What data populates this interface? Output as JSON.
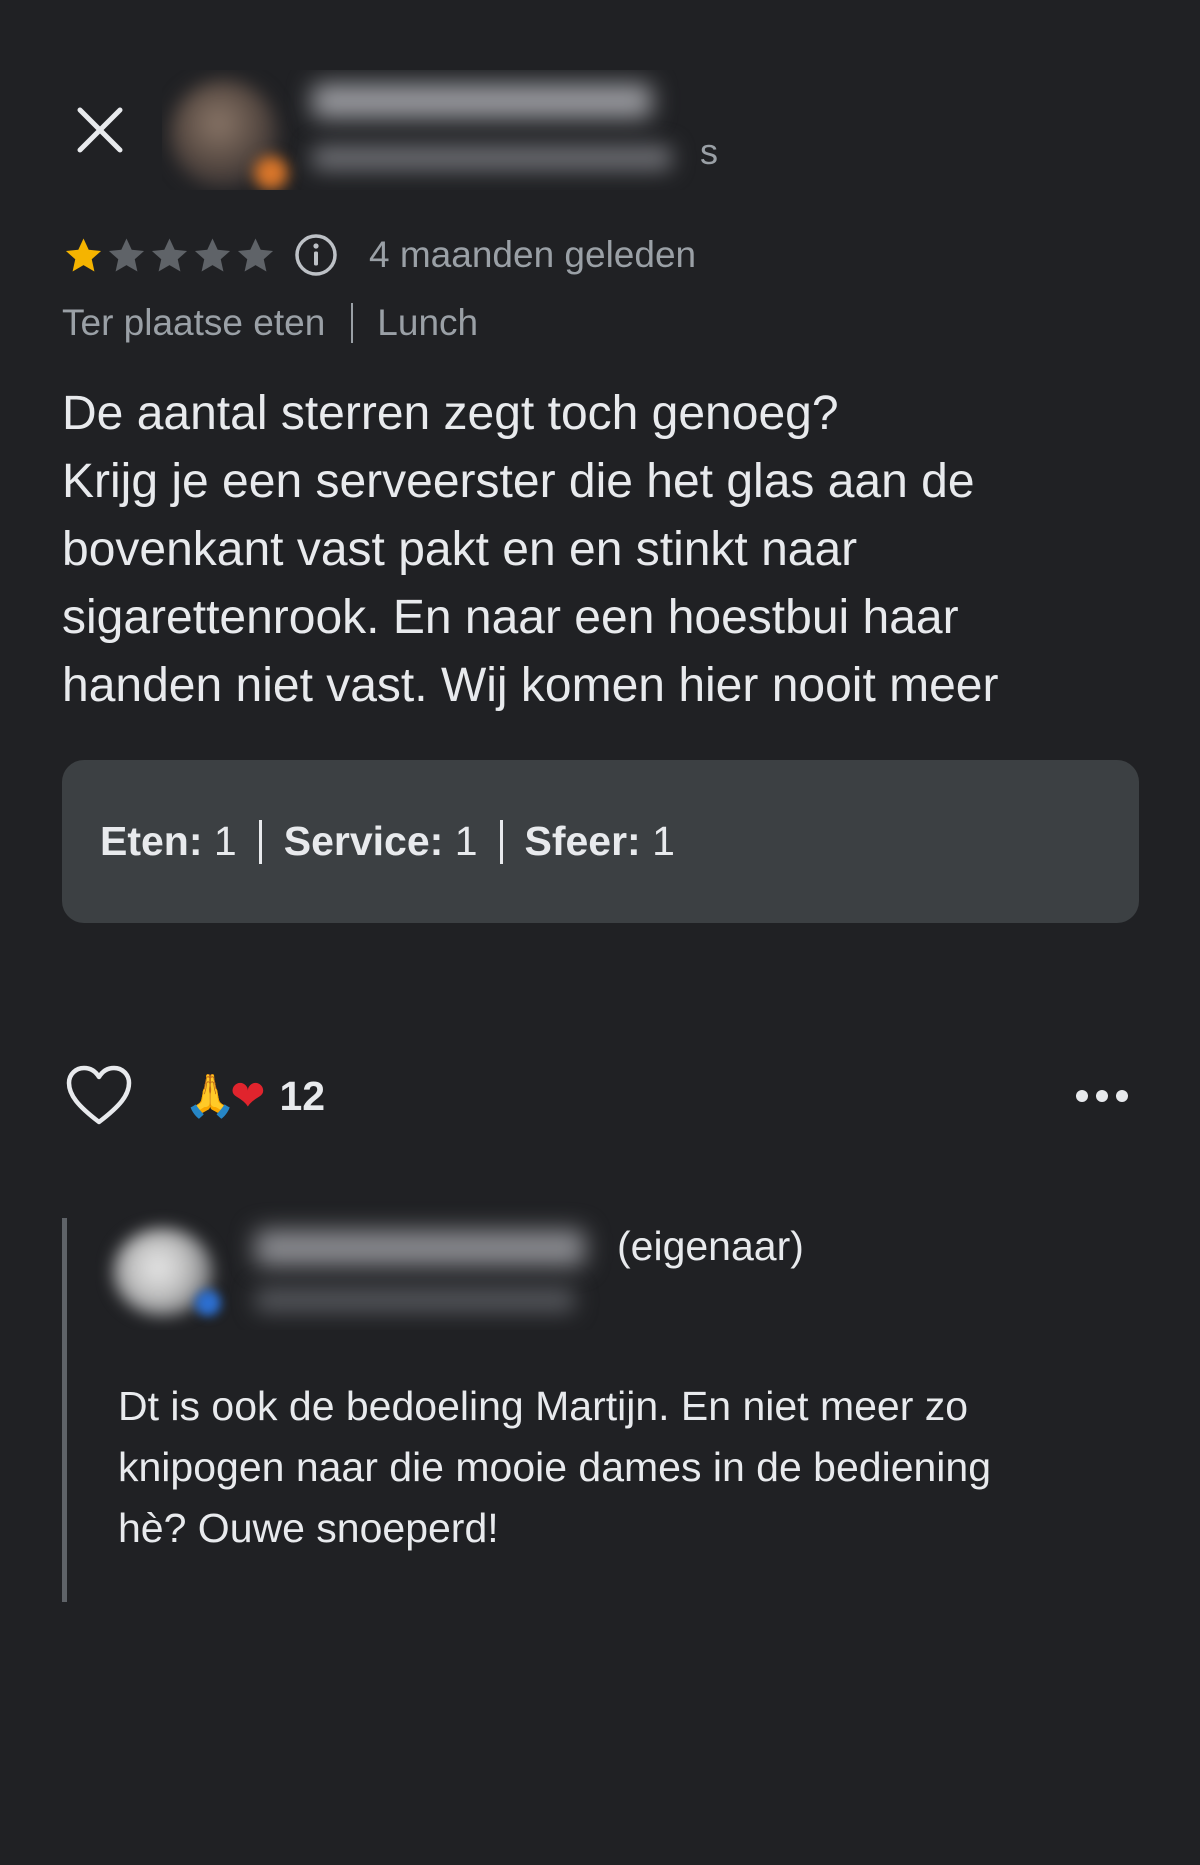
{
  "header": {
    "close_icon": "close-icon",
    "reviewer_name": "",
    "reviewer_meta_tail": "s"
  },
  "review": {
    "rating": 1,
    "max_rating": 5,
    "star_color_filled": "#F5B400",
    "star_color_empty": "#5f6368",
    "time_ago": "4 maanden geleden",
    "dining_type": "Ter plaatse eten",
    "meal_type": "Lunch",
    "text": "De aantal sterren zegt toch genoeg?\nKrijg je een serveerster die het glas aan de\nbovenkant vast pakt en en stinkt naar\nsigarettenrook. En naar een hoestbui haar\nhanden niet vast. Wij komen hier nooit meer"
  },
  "subratings": [
    {
      "label": "Eten:",
      "value": "1"
    },
    {
      "label": "Service:",
      "value": "1"
    },
    {
      "label": "Sfeer:",
      "value": "1"
    }
  ],
  "actions": {
    "like_icon": "heart-outline-icon",
    "reaction_emojis": [
      "🙏",
      "❤"
    ],
    "reaction_count": "12",
    "more_icon": "more-horizontal-icon"
  },
  "owner_reply": {
    "owner_label": "(eigenaar)",
    "text": "Dt is ook de bedoeling Martijn. En niet meer zo\nknipogen naar die mooie dames in de bediening\nhè? Ouwe snoeperd!"
  }
}
